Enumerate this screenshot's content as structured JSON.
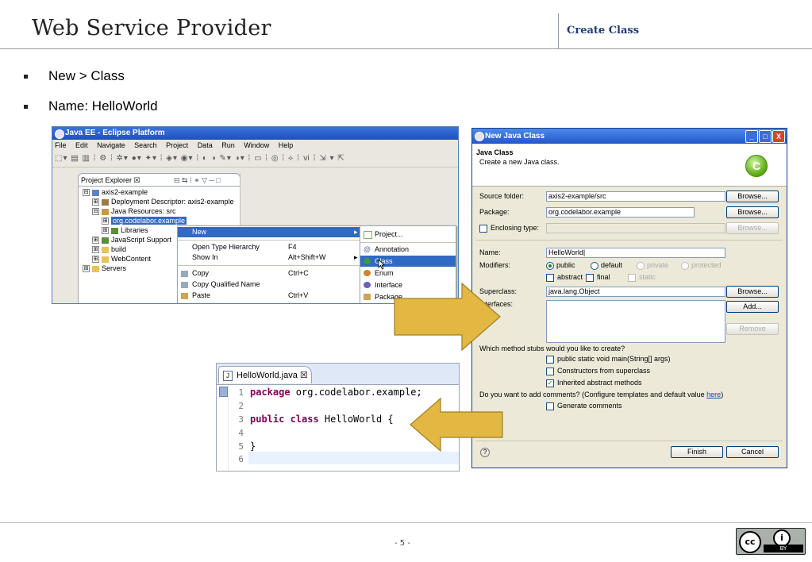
{
  "header": {
    "title": "Web Service Provider",
    "section": "Create Class"
  },
  "bullets": [
    {
      "text": "New > Class"
    },
    {
      "text": "Name: HelloWorld"
    }
  ],
  "footer": {
    "page": "- 5 -",
    "license": {
      "cc": "cc",
      "by_symbol": "i",
      "by_label": "BY"
    }
  },
  "eclipse": {
    "title": "Java EE - Eclipse Platform",
    "menu": [
      "File",
      "Edit",
      "Navigate",
      "Search",
      "Project",
      "Data",
      "Run",
      "Window",
      "Help"
    ],
    "view_tab": "Project Explorer ☒",
    "tree": [
      {
        "label": "axis2-example",
        "toggle": "⊟"
      },
      {
        "label": "Deployment Descriptor: axis2-example",
        "toggle": "⊞"
      },
      {
        "label": "Java Resources: src",
        "toggle": "⊟"
      },
      {
        "label": "org.codelabor.example",
        "toggle": "⊞"
      },
      {
        "label": "Libraries",
        "toggle": "⊞"
      },
      {
        "label": "JavaScript Support",
        "toggle": "⊞"
      },
      {
        "label": "build",
        "toggle": "⊞"
      },
      {
        "label": "WebContent",
        "toggle": "⊞"
      },
      {
        "label": "Servers",
        "toggle": "⊞"
      }
    ],
    "context_menu": [
      {
        "label": "New",
        "shortcut": "",
        "arrow": "▸"
      },
      {
        "label": "Open Type Hierarchy",
        "shortcut": "F4"
      },
      {
        "label": "Show In",
        "shortcut": "Alt+Shift+W",
        "arrow": "▸"
      },
      {
        "label": "Copy",
        "shortcut": "Ctrl+C"
      },
      {
        "label": "Copy Qualified Name",
        "shortcut": ""
      },
      {
        "label": "Paste",
        "shortcut": "Ctrl+V"
      }
    ],
    "submenu": [
      "Project...",
      "Annotation",
      "Class",
      "Enum",
      "Interface",
      "Package"
    ]
  },
  "dialog": {
    "title": "New Java Class",
    "heading": "Java Class",
    "description": "Create a new Java class.",
    "logo_letter": "C",
    "source_folder": {
      "label": "Source folder:",
      "value": "axis2-example/src",
      "button": "Browse..."
    },
    "package": {
      "label": "Package:",
      "value": "org.codelabor.example",
      "button": "Browse..."
    },
    "enclosing_type": {
      "label": "Enclosing type:",
      "value": "",
      "button": "Browse..."
    },
    "name": {
      "label": "Name:",
      "value": "HelloWorld|"
    },
    "modifiers": {
      "label": "Modifiers:",
      "visibility": [
        "public",
        "default",
        "private",
        "protected"
      ],
      "selected": "public",
      "flags": [
        "abstract",
        "final",
        "static"
      ]
    },
    "superclass": {
      "label": "Superclass:",
      "value": "java.lang.Object",
      "button": "Browse..."
    },
    "interfaces": {
      "label": "Interfaces:",
      "add_button": "Add...",
      "remove_button": "Remove"
    },
    "stubs": {
      "question": "Which method stubs would you like to create?",
      "options": [
        {
          "label": "public static void main(String[] args)",
          "checked": false
        },
        {
          "label": "Constructors from superclass",
          "checked": false
        },
        {
          "label": "Inherited abstract methods",
          "checked": true
        }
      ]
    },
    "comments": {
      "question_prefix": "Do you want to add comments? (Configure templates and default value ",
      "link": "here",
      "question_suffix": ")",
      "option": "Generate comments"
    },
    "help_symbol": "?",
    "finish": "Finish",
    "cancel": "Cancel",
    "win_buttons": [
      "_",
      "□",
      "X"
    ]
  },
  "editor": {
    "tab": "HelloWorld.java ☒",
    "tab_icon": "J",
    "lines": [
      {
        "no": "1",
        "kw": "package",
        "rest": " org.codelabor.example;"
      },
      {
        "no": "2",
        "kw": "",
        "rest": ""
      },
      {
        "no": "3",
        "kw": "public class",
        "rest": " HelloWorld {"
      },
      {
        "no": "4",
        "kw": "",
        "rest": ""
      },
      {
        "no": "5",
        "kw": "",
        "rest": "}"
      },
      {
        "no": "6",
        "kw": "",
        "rest": ""
      }
    ]
  },
  "colors": {
    "arrow": "#e3b842",
    "title_blue": "#1f3d73",
    "keyword": "#7f0055",
    "xp_title": "#2456c9"
  }
}
